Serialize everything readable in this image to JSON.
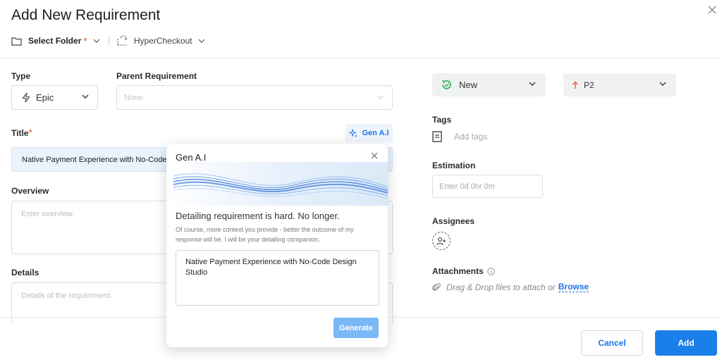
{
  "header": {
    "title": "Add New Requirement",
    "folder_label": "Select Folder",
    "required_mark": "*",
    "project_name": "HyperCheckout"
  },
  "form": {
    "type_label": "Type",
    "type_value": "Epic",
    "parent_label": "Parent Requirement",
    "parent_placeholder": "None",
    "title_label": "Title",
    "title_required_mark": "*",
    "genai_button": "Gen A.I",
    "title_value": "Native Payment Experience with No-Code D",
    "overview_label": "Overview",
    "overview_placeholder": "Enter overview.",
    "details_label": "Details",
    "details_placeholder": "Details of the requirement."
  },
  "sidebar": {
    "status_value": "New",
    "priority_value": "P2",
    "tags_label": "Tags",
    "tags_placeholder": "Add tags",
    "estimation_label": "Estimation",
    "estimation_placeholder": "Enter 0d 0hr 0m",
    "assignees_label": "Assignees",
    "attachments_label": "Attachments",
    "attach_text": "Drag & Drop files to attach or",
    "browse_link": "Browse"
  },
  "footer": {
    "cancel_label": "Cancel",
    "add_label": "Add"
  },
  "genai_popup": {
    "title": "Gen A.I",
    "heading": "Detailing requirement is hard. No longer.",
    "subtext": "Of course, more context you provide - better the outcome of my response will be. I will be your detailing companion.",
    "prompt_text": "Native Payment Experience with No-Code Design Studio",
    "generate_label": "Generate"
  },
  "colors": {
    "accent": "#1a73e8",
    "required": "#f05a28",
    "status_green": "#2eaa4f",
    "priority_orange": "#f05a28"
  },
  "icons": [
    "close-icon",
    "folder-icon",
    "chevron-down-icon",
    "project-icon",
    "bolt-icon",
    "sparkle-icon",
    "status-cycle-icon",
    "arrow-up-icon",
    "tag-doc-icon",
    "add-user-icon",
    "info-icon",
    "paperclip-icon",
    "wave-illustration"
  ]
}
